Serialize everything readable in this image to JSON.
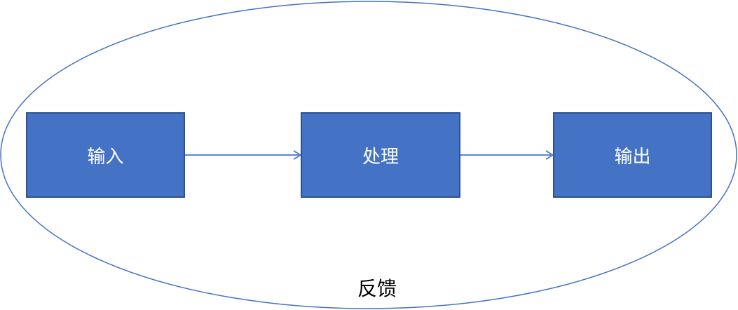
{
  "nodes": {
    "input": "输入",
    "process": "处理",
    "output": "输出"
  },
  "feedback_label": "反馈",
  "colors": {
    "fill": "#4472C4",
    "border": "#2F528F",
    "line": "#4472C4"
  }
}
